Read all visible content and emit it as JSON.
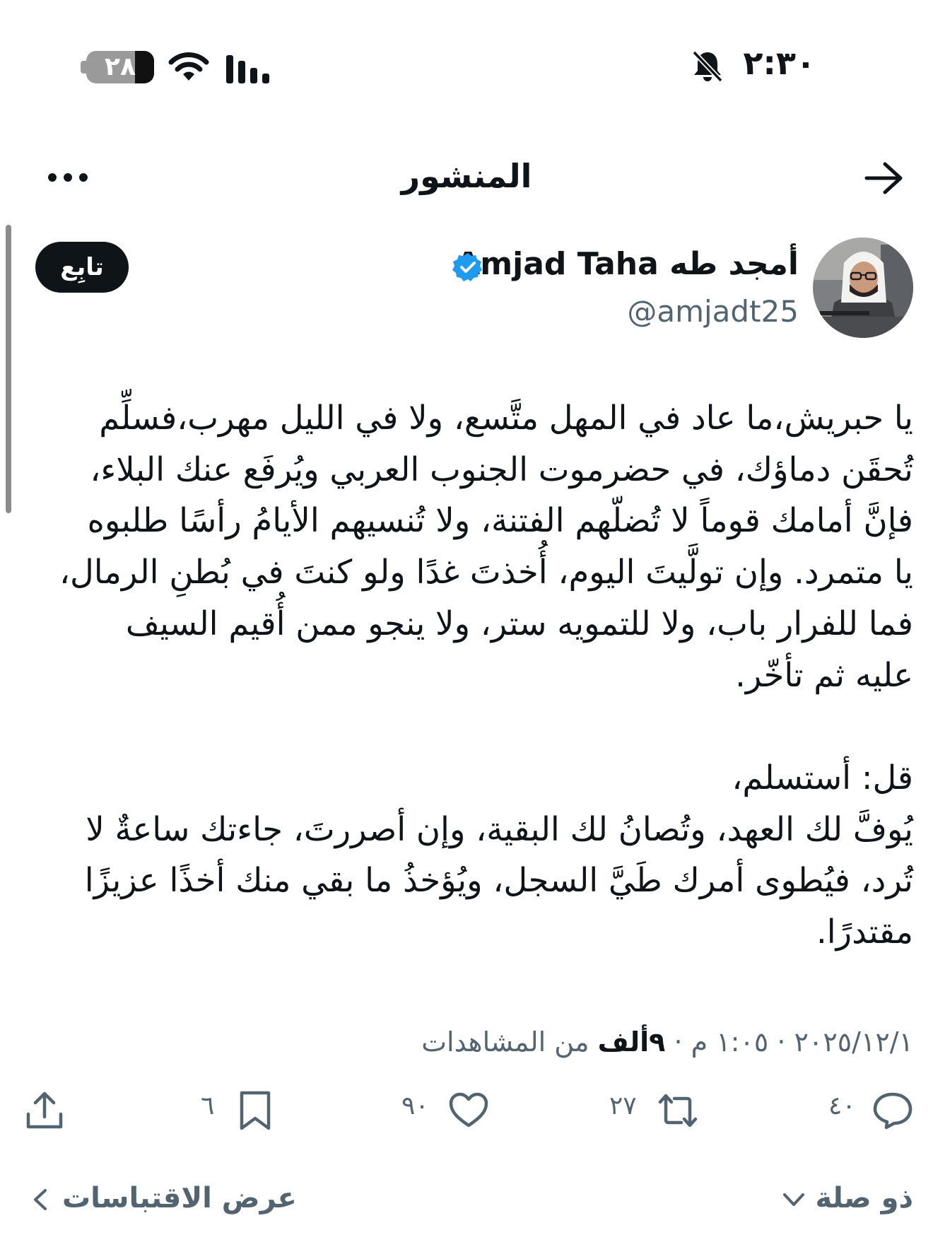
{
  "status_bar": {
    "time": "٢:٣٠",
    "battery_level": "٢٨",
    "battery_fraction": 0.28
  },
  "header": {
    "title": "المنشور"
  },
  "author": {
    "name": "أمجد طه Amjad Taha",
    "handle": "@amjadt25",
    "verified": true,
    "follow_label": "تابِع"
  },
  "post": {
    "lines": [
      "يا حبريش،ما عاد في المهل متَّسع، ولا في الليل مهرب،فسلِّم",
      "تُحقَن دماؤك، في حضرموت الجنوب العربي ويُرفَع عنك البلاء،",
      "فإنَّ أمامك قوماً لا تُضلّهم الفتنة، ولا تُنسيهم الأيامُ رأسًا طلبوه",
      "يا متمرد. وإن تولَّيتَ اليوم، أُخذتَ غدًا ولو كنتَ في بُطنِ الرمال،",
      "فما للفرار باب، ولا للتمويه ستر، ولا ينجو ممن أُقيم السيف",
      "عليه ثم تأخّر.",
      "",
      "قل: أستسلم،",
      "يُوفَّ لك العهد، وتُصانُ لك البقية، وإن أصررتَ، جاءتك ساعةٌ لا",
      "تُرد، فيُطوى أمرك طَيَّ السجل، ويُؤخذُ ما بقي منك أخذًا عزيزًا",
      "مقتدرًا."
    ]
  },
  "meta": {
    "date_time": "٢٠٢٥/١٢/١ · ١:٠٥ م · ",
    "views_value": "٩ألف",
    "views_suffix": " من المشاهدات"
  },
  "actions": {
    "replies": "٤٠",
    "reposts": "٢٧",
    "likes": "٩٠",
    "bookmarks": "٦"
  },
  "footer": {
    "relevance": "ذو صلة",
    "quotes": "عرض الاقتباسات"
  },
  "colors": {
    "text": "#0f1419",
    "secondary": "#536471",
    "verified": "#1d9bf0",
    "follow_bg": "#0f1419"
  }
}
